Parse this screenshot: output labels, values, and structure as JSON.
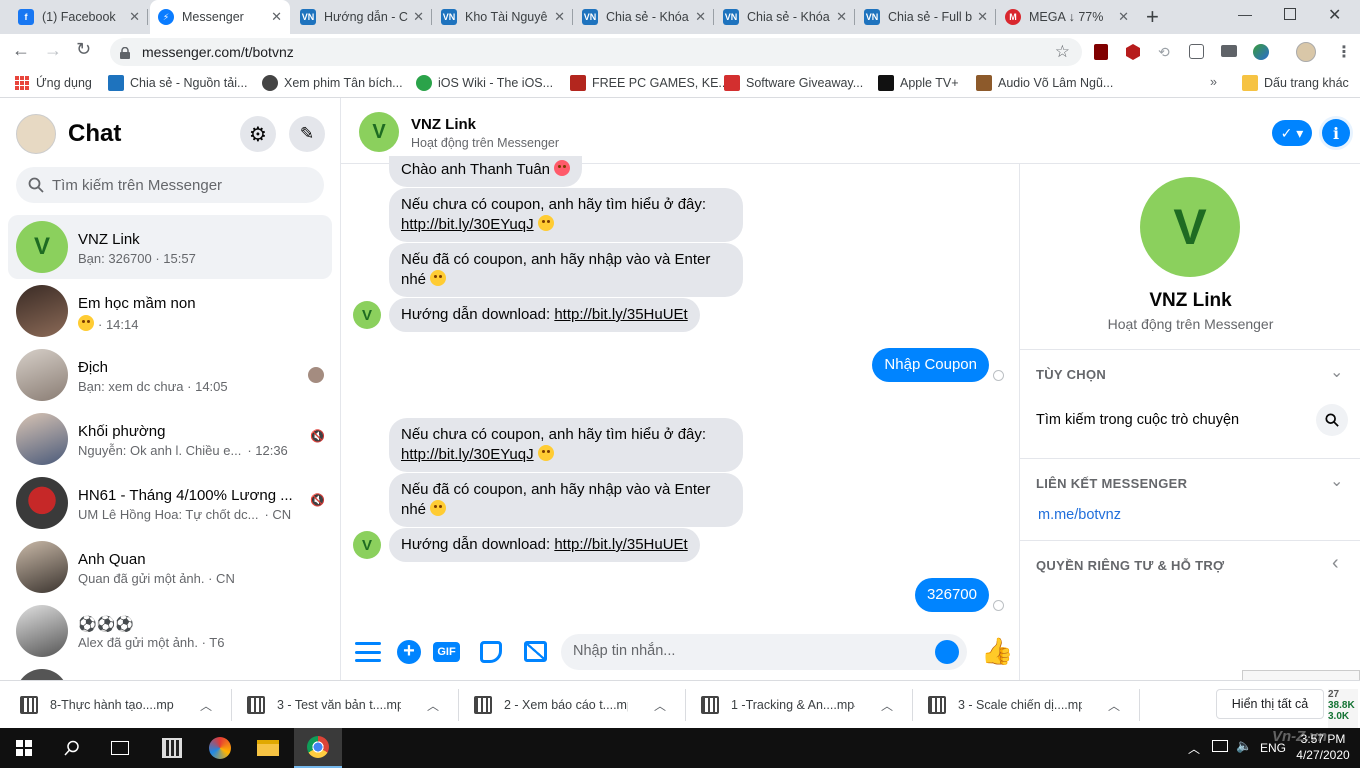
{
  "browser": {
    "tabs": [
      {
        "title": "(1) Facebook",
        "icon": "facebook-icon",
        "color": "#1877f2"
      },
      {
        "title": "Messenger",
        "icon": "messenger-icon",
        "color": "#0a7cff"
      },
      {
        "title": "Hướng dẫn - C",
        "icon": "vn-zoom-icon",
        "color": "#1e73be"
      },
      {
        "title": "Kho Tài Nguyê",
        "icon": "vn-zoom-icon",
        "color": "#1e73be"
      },
      {
        "title": "Chia sẻ - Khóa",
        "icon": "vn-zoom-icon",
        "color": "#1e73be"
      },
      {
        "title": "Chia sẻ - Khóa",
        "icon": "vn-zoom-icon",
        "color": "#1e73be"
      },
      {
        "title": "Chia sẻ - Full b",
        "icon": "vn-zoom-icon",
        "color": "#1e73be"
      },
      {
        "title": "MEGA ↓ 77%",
        "icon": "mega-icon",
        "color": "#d9272e"
      }
    ],
    "url": "messenger.com/t/botvnz",
    "bookmarks": [
      {
        "label": "Ứng dụng",
        "icon": "apps-grid-icon"
      },
      {
        "label": "Chia sẻ - Nguồn tải...",
        "icon": "vn-zoom-icon"
      },
      {
        "label": "Xem phim Tân bích...",
        "icon": "film-reel-icon"
      },
      {
        "label": "iOS Wiki - The iOS...",
        "icon": "ios-wiki-icon"
      },
      {
        "label": "FREE PC GAMES, KE...",
        "icon": "games-icon"
      },
      {
        "label": "Software Giveaway...",
        "icon": "gift-icon"
      },
      {
        "label": "Apple TV+",
        "icon": "apple-tv-icon"
      },
      {
        "label": "Audio Võ Lâm Ngũ...",
        "icon": "book-icon"
      },
      {
        "label": "Dấu trang khác",
        "icon": "folder-icon"
      }
    ]
  },
  "sidebar": {
    "title": "Chat",
    "search_placeholder": "Tìm kiếm trên Messenger",
    "conversations": [
      {
        "name": "VNZ Link",
        "preview": "Bạn: 326700 · 15:57",
        "avatar_letter": "V"
      },
      {
        "name": "Em học mầm non",
        "preview": "· 14:14"
      },
      {
        "name": "Địch",
        "preview": "Bạn: xem dc chưa · 14:05"
      },
      {
        "name": "Khối phường",
        "preview_text": "Nguyễn: Ok anh l. Chiều e...",
        "preview_time": "· 12:36"
      },
      {
        "name": "HN61 - Tháng 4/100% Lương ...",
        "preview_text": "UM Lê Hồng Hoa: Tự chốt dc...",
        "preview_time": "· CN"
      },
      {
        "name": "Anh Quan",
        "preview": "Quan đã gửi một ảnh. · CN"
      },
      {
        "name": "⚽⚽⚽",
        "preview": "Alex đã gửi một ảnh. · T6"
      }
    ]
  },
  "chat": {
    "name": "VNZ Link",
    "status": "Hoạt động trên Messenger",
    "avatar_letter": "V",
    "messages": {
      "greet": "Chào anh Thanh Tuân",
      "coupon_q1_text": "Nếu chưa có coupon, anh hãy tìm hiểu ở đây:",
      "coupon_q1_link": "http://bit.ly/30EYuqJ",
      "coupon_has_1": "Nếu đã có coupon, anh hãy nhập vào và Enter",
      "coupon_has_2": "nhé",
      "download_text": "Hướng dẫn download:",
      "download_link": "http://bit.ly/35HuUEt",
      "me_1": "Nhập Coupon",
      "me_2": "326700"
    },
    "composer_placeholder": "Nhập tin nhắn...",
    "accent": "#0084ff"
  },
  "info_panel": {
    "name": "VNZ Link",
    "status": "Hoạt động trên Messenger",
    "avatar_letter": "V",
    "options_header": "TÙY CHỌN",
    "search_convo": "Tìm kiếm trong cuộc trò chuyện",
    "links_header": "LIÊN KẾT MESSENGER",
    "link": "m.me/botvnz",
    "privacy_header": "QUYỀN RIÊNG TƯ & HỖ TRỢ"
  },
  "downloads": {
    "items": [
      "8-Thực hành tạo....mp4",
      "3 - Test văn bản t....mp4",
      "2 - Xem báo cáo t....mp4",
      "1 -Tracking & An....mp4",
      "3 - Scale chiến dị....mp4"
    ],
    "show_all": "Hiển thị tất cả"
  },
  "taskbar": {
    "lang": "ENG",
    "time": "3:57 PM",
    "date": "4/27/2020",
    "net_values": [
      "27",
      "38.8K",
      "3.0K"
    ],
    "watermark": "Vn-Z.vn"
  }
}
